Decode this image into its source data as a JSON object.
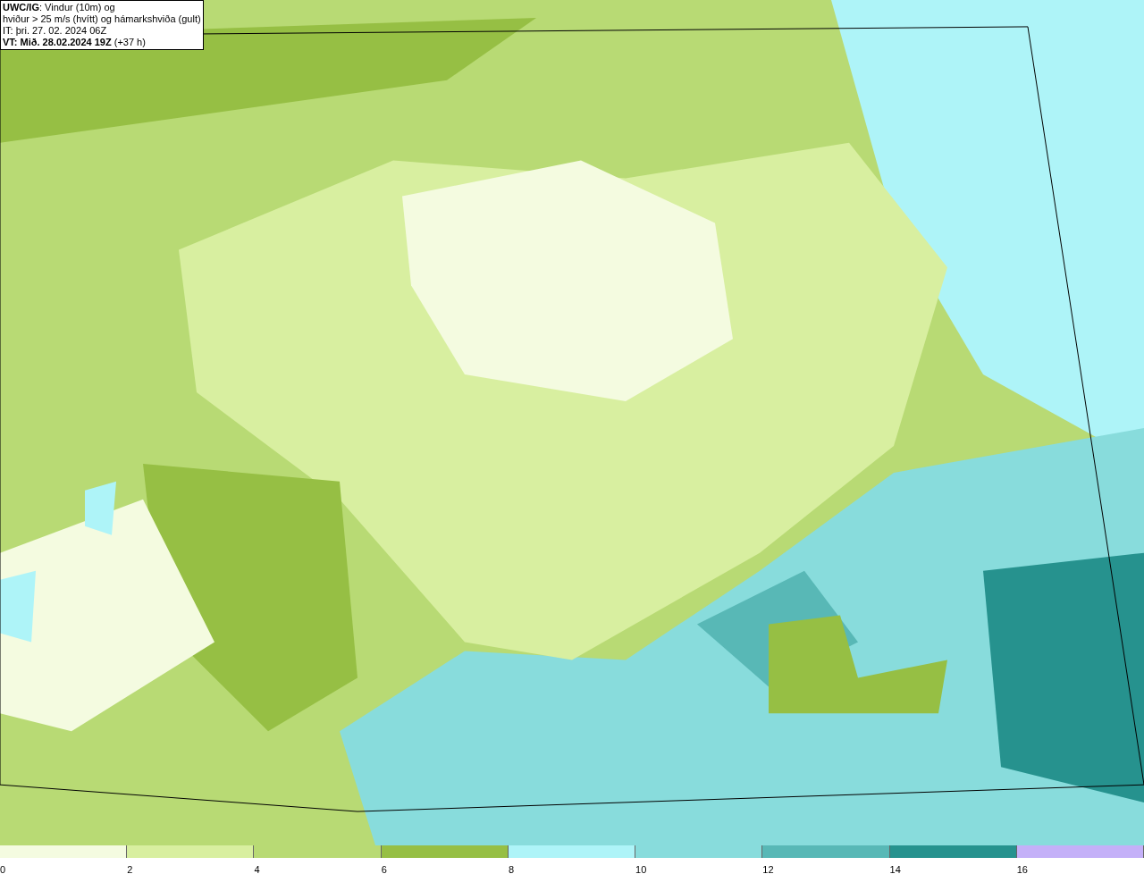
{
  "title_box": {
    "lines": [
      "**UWC/IG**: Vindur (10m) og",
      "hviður > 25 m/s (hvítt) og hámarkshviða (gult)",
      "IT: þri. 27. 02. 2024 06Z",
      "**VT: Mið. 28.02.2024 19Z** (+37 h)"
    ]
  },
  "legend": [
    {
      "label": "0",
      "color": "#f4fbe0"
    },
    {
      "label": "2",
      "color": "#d8efa0"
    },
    {
      "label": "4",
      "color": "#b8da74"
    },
    {
      "label": "6",
      "color": "#96bf44"
    },
    {
      "label": "8",
      "color": "#aef4f8"
    },
    {
      "label": "10",
      "color": "#88dcdc"
    },
    {
      "label": "12",
      "color": "#58b8b6"
    },
    {
      "label": "14",
      "color": "#26928e"
    },
    {
      "label": "16",
      "color": "#c4b0f8"
    }
  ]
}
